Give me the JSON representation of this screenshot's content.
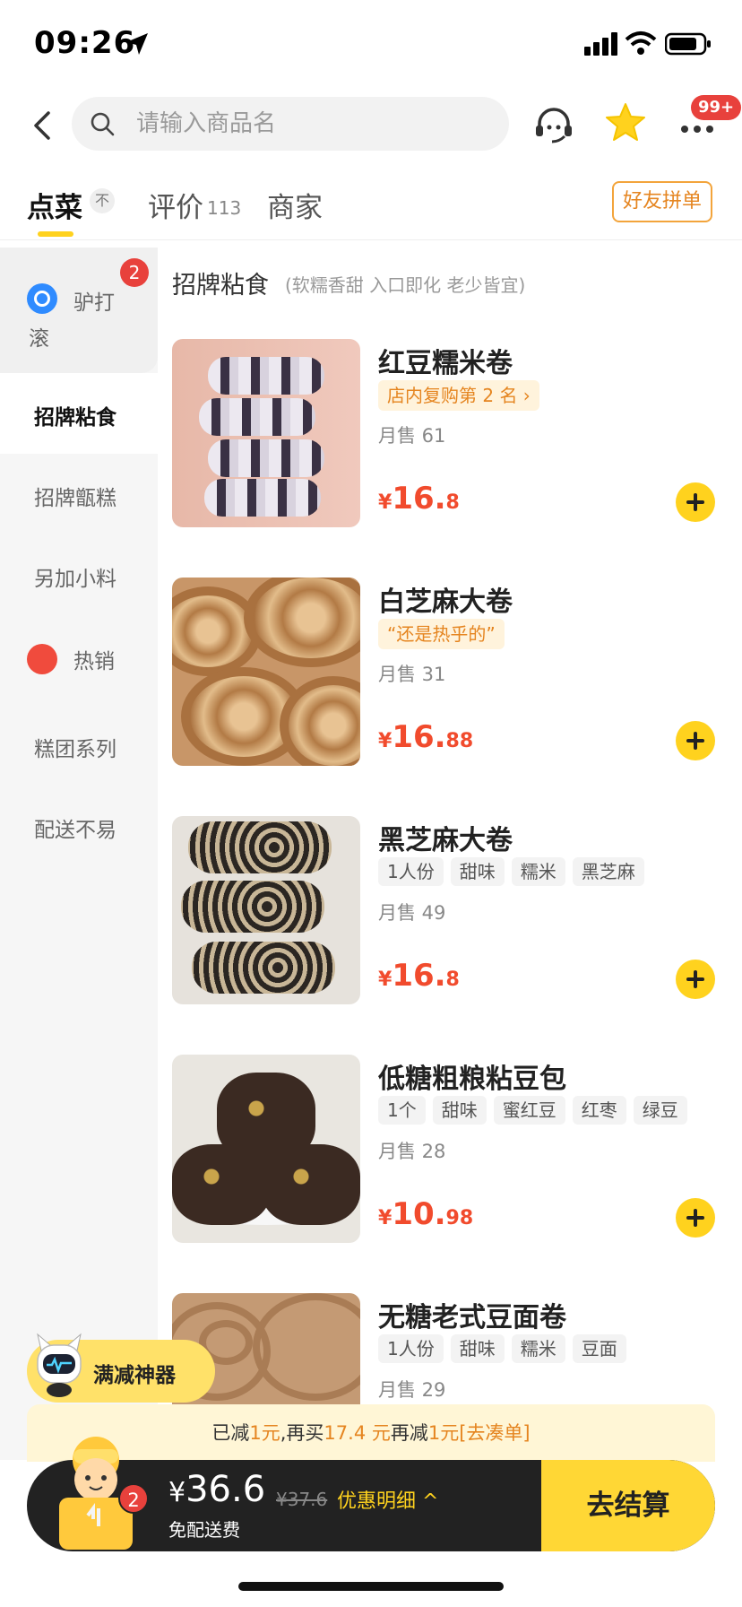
{
  "status_bar": {
    "time": "09:26"
  },
  "search": {
    "placeholder": "请输入商品名"
  },
  "header": {
    "more_badge": "99+"
  },
  "tabs": [
    {
      "label": "点菜"
    },
    {
      "label": "评价",
      "count": "113"
    },
    {
      "label": "商家"
    }
  ],
  "tab_order_pin": "不",
  "group_order_button": "好友拼单",
  "sidebar": {
    "items": [
      {
        "label_line1": "驴打",
        "label_line2": "滚",
        "badge": "2"
      },
      {
        "label": "招牌粘食"
      },
      {
        "label": "招牌甑糕"
      },
      {
        "label": "另加小料"
      },
      {
        "label": "热销"
      },
      {
        "label": "糕团系列"
      },
      {
        "label": "配送不易"
      }
    ]
  },
  "section": {
    "title": "招牌粘食",
    "subtitle": "(软糯香甜 入口即化 老少皆宜)"
  },
  "products": [
    {
      "name": "红豆糯米卷",
      "highlight": "店内复购第 2 名 ›",
      "sold": "月售 61",
      "price_int": "16.",
      "price_dec": "8",
      "currency": "¥"
    },
    {
      "name": "白芝麻大卷",
      "highlight": "“还是热乎的”",
      "sold": "月售 31",
      "price_int": "16.",
      "price_dec": "88",
      "currency": "¥"
    },
    {
      "name": "黑芝麻大卷",
      "tags": [
        "1人份",
        "甜味",
        "糯米",
        "黑芝麻"
      ],
      "sold": "月售 49",
      "price_int": "16.",
      "price_dec": "8",
      "currency": "¥"
    },
    {
      "name": "低糖粗粮粘豆包",
      "tags": [
        "1个",
        "甜味",
        "蜜红豆",
        "红枣",
        "绿豆"
      ],
      "sold": "月售 28",
      "price_int": "10.",
      "price_dec": "98",
      "currency": "¥"
    },
    {
      "name": "无糖老式豆面卷",
      "tags": [
        "1人份",
        "甜味",
        "糯米",
        "豆面"
      ],
      "sold": "月售 29"
    }
  ],
  "promo_float": {
    "label": "满减神器"
  },
  "discount_bar": {
    "part1": "已减",
    "reduced": "1元",
    "part2": ",再买",
    "more": "17.4 元",
    "part3": "再减",
    "next": "1元",
    "action": "[去凑单]"
  },
  "cart": {
    "badge": "2",
    "currency": "¥",
    "total": "36.6",
    "original": "¥37.6",
    "detail_label": "优惠明细 ^",
    "delivery": "免配送费",
    "checkout_label": "去结算"
  },
  "colors": {
    "accent_yellow": "#ffd21e",
    "price_red": "#f14b2d",
    "badge_red": "#e8413c",
    "highlight_orange": "#e58520",
    "cart_dark": "#222222"
  },
  "icons": {
    "back": "chevron-left-icon",
    "search": "search-icon",
    "service": "customer-service-icon",
    "favorite": "star-icon",
    "more": "more-dots-icon",
    "add": "plus-icon"
  }
}
